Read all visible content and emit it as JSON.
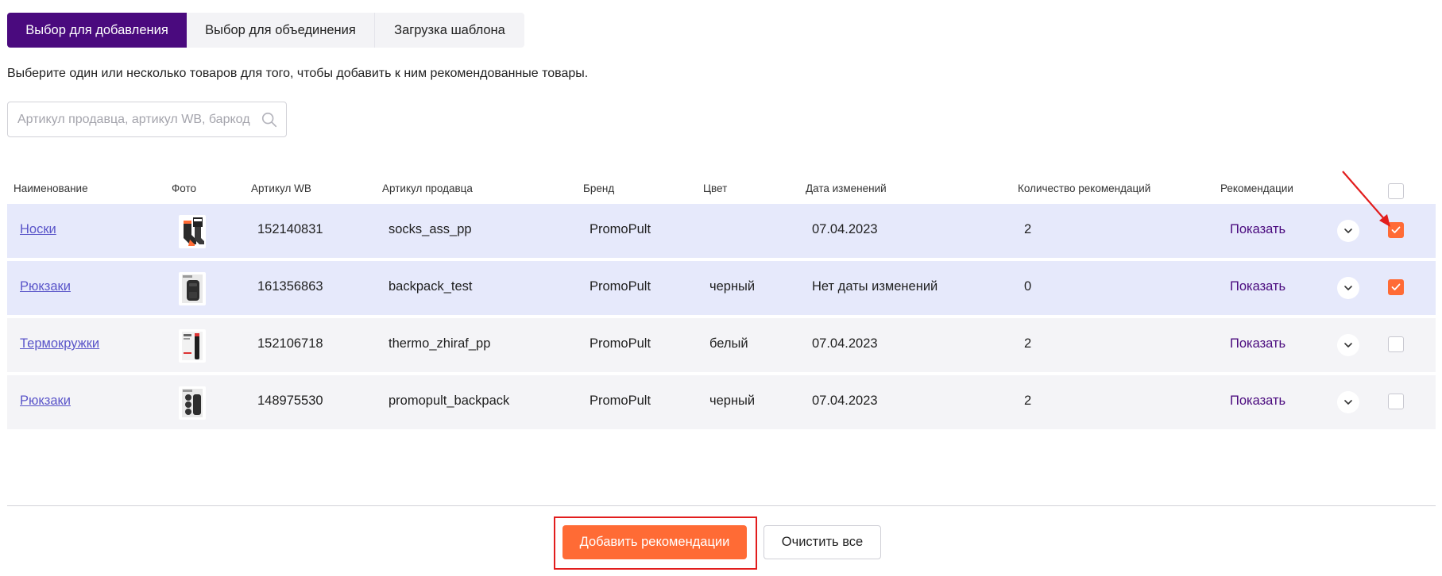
{
  "tabs": [
    {
      "label": "Выбор для добавления",
      "active": true
    },
    {
      "label": "Выбор для объединения",
      "active": false
    },
    {
      "label": "Загрузка шаблона",
      "active": false
    }
  ],
  "hint": "Выберите один или несколько товаров для того, чтобы добавить к ним рекомендованные товары.",
  "search": {
    "placeholder": "Артикул продавца, артикул WB, баркод"
  },
  "columns": {
    "name": "Наименование",
    "photo": "Фото",
    "wb": "Артикул WB",
    "seller": "Артикул продавца",
    "brand": "Бренд",
    "color": "Цвет",
    "date": "Дата изменений",
    "count": "Количество рекомендаций",
    "recs": "Рекомендации"
  },
  "rows": [
    {
      "name": "Носки",
      "wb": "152140831",
      "seller": "socks_ass_pp",
      "brand": "PromoPult",
      "color": "",
      "date": "07.04.2023",
      "count": "2",
      "show": "Показать",
      "checked": true,
      "photo_icon": "socks-photo"
    },
    {
      "name": "Рюкзаки",
      "wb": "161356863",
      "seller": "backpack_test",
      "brand": "PromoPult",
      "color": "черный",
      "date": "Нет даты изменений",
      "count": "0",
      "show": "Показать",
      "checked": true,
      "photo_icon": "backpack-photo"
    },
    {
      "name": "Термокружки",
      "wb": "152106718",
      "seller": "thermo_zhiraf_pp",
      "brand": "PromoPult",
      "color": "белый",
      "date": "07.04.2023",
      "count": "2",
      "show": "Показать",
      "checked": false,
      "photo_icon": "thermo-mug-photo"
    },
    {
      "name": "Рюкзаки",
      "wb": "148975530",
      "seller": "promopult_backpack",
      "brand": "PromoPult",
      "color": "черный",
      "date": "07.04.2023",
      "count": "2",
      "show": "Показать",
      "checked": false,
      "photo_icon": "backpack-photo"
    }
  ],
  "buttons": {
    "add": "Добавить рекомендации",
    "clear": "Очистить все"
  },
  "colors": {
    "accent": "#ff6b35",
    "primary": "#4a0a7e",
    "link": "#5a55c9",
    "highlight": "#e21d1d",
    "row_selected": "#e6e9fb",
    "row": "#f4f4f7"
  }
}
